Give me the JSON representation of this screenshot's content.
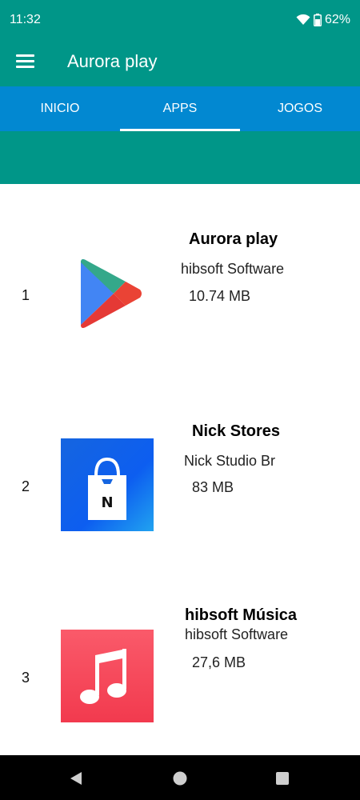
{
  "status_bar": {
    "time": "11:32",
    "battery": "62%",
    "wifi_icon": "wifi-icon",
    "battery_icon": "battery-icon"
  },
  "app_bar": {
    "title": "Aurora play",
    "menu_icon": "hamburger-menu-icon"
  },
  "tabs": [
    {
      "label": "INICIO",
      "active": false
    },
    {
      "label": "APPS",
      "active": true
    },
    {
      "label": "JOGOS",
      "active": false
    }
  ],
  "apps": [
    {
      "rank": "1",
      "name": "Aurora play",
      "developer": "hibsoft Software",
      "size": "10.74 MB",
      "icon": "play-store-icon"
    },
    {
      "rank": "2",
      "name": "Nick Stores",
      "developer": "Nick Studio Br",
      "size": "83 MB",
      "icon": "shopping-bag-icon"
    },
    {
      "rank": "3",
      "name": "hibsoft Música",
      "developer": "hibsoft Software",
      "size": "27,6 MB",
      "icon": "music-note-icon"
    }
  ],
  "nav_bar": {
    "back_icon": "back-icon",
    "home_icon": "home-icon",
    "recents_icon": "recents-icon"
  },
  "colors": {
    "primary": "#009688",
    "tab_bar": "#0288d1",
    "nav_bar": "#000000"
  }
}
